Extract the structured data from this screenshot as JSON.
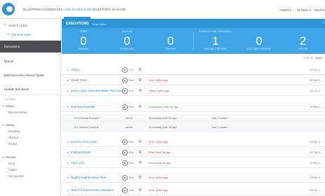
{
  "nav": {
    "tabs": [
      "BLUEPRINTS",
      "SANDBOXES",
      "JOB SCHEDULING",
      "INVENTORY",
      "MANAGE"
    ],
    "admin": "ADMIN ▾",
    "domain": "GLOBAL ▾",
    "help": "HELP ▾"
  },
  "sidebar": {
    "search_placeholder": "Search suites",
    "add_new": "Add new suite",
    "active": "Executions",
    "links": [
      "Queue",
      "Edit Execution Server Types",
      "Update test items"
    ],
    "section_header": "FILTERS",
    "groups": [
      {
        "label": "Suites",
        "items": [
          "My executions"
        ]
      },
      {
        "label": "Status",
        "items": [
          "Pending",
          "Started",
          "Ended"
        ]
      },
      {
        "label": "Results",
        "items": [
          "Error",
          "Failed",
          "Succeeded"
        ]
      }
    ]
  },
  "banner": {
    "title": "EXECUTIONS",
    "view_filter": "Show filters"
  },
  "stats": [
    {
      "label": "JOBS",
      "value": "0",
      "sub": "RUNNING"
    },
    {
      "label": "QUEUE",
      "value": "0",
      "sub": "SCHEDULED"
    },
    {
      "label": "",
      "value": "0",
      "sub": "PENDING"
    },
    {
      "label": "EXECUTION SERVERS",
      "value": "1",
      "sub": "AVAILABLE SERVERS"
    },
    {
      "label": "",
      "value": "0",
      "sub": "EXCLUDED SERVERS"
    },
    {
      "label": "",
      "value": "2",
      "sub": "OFFLINE"
    }
  ],
  "sort": {
    "label": "SORT BY",
    "value": "Name"
  },
  "run_label": "Run",
  "details_label": "DETAILS",
  "jobs": [
    {
      "name": "Admin",
      "status": "",
      "status_type": ""
    },
    {
      "name": "Client Suite",
      "status": "Error 1y/5m ago",
      "status_type": "err"
    },
    {
      "name": "GSSA QDS Interoperability Test Suite",
      "status": "Failed 2y/6m ago",
      "status_type": "err"
    },
    {
      "name": "Gamma Example",
      "status": "Succeeded 1mth 3w ago",
      "status_type": "ok"
    },
    {
      "name": "Gamma Test Suite",
      "status": "Error 1y/5m ago",
      "status_type": "err"
    },
    {
      "name": "Oakland Suite",
      "status": "Error 8mth 3w ago",
      "status_type": "err"
    },
    {
      "name": "ASCI Cld",
      "status": "Error 8mth 3w ago",
      "status_type": "err"
    },
    {
      "name": "Nightly Maintenance Run",
      "status": "Error 2y/6m ago",
      "status_type": "err"
    },
    {
      "name": "NMAP Infrastructure Validation",
      "status": "Error 1y/5m ago",
      "status_type": "err"
    }
  ],
  "expanded_runs": [
    {
      "id": "#13 Gamma Example",
      "user": "admin",
      "result": "Succeeded 1mth 3w ago",
      "jobs": "Jobs: 1 ended"
    },
    {
      "id": "#11 Gamma Example",
      "user": "admin",
      "result": "Succeeded 1mth 3w ago",
      "jobs": "Jobs: 1 ended"
    }
  ]
}
